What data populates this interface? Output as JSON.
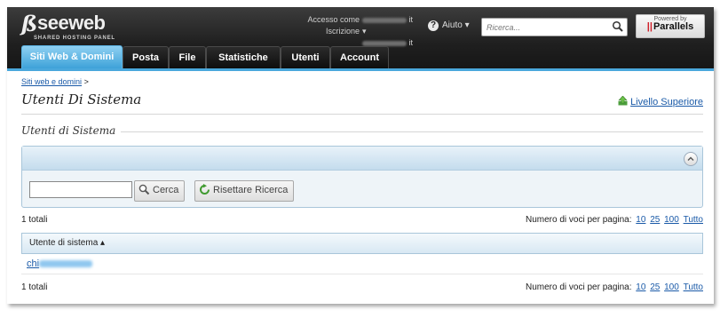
{
  "header": {
    "logo_text": "seeweb",
    "logo_sub": "SHARED HOSTING PANEL",
    "access_label": "Accesso come",
    "signup_label": "Iscrizione",
    "access_suffix": "it",
    "signup_suffix": "it",
    "help_label": "Aiuto",
    "search_placeholder": "Ricerca...",
    "powered_by": "Powered by",
    "parallels": "Parallels"
  },
  "tabs": [
    {
      "label": "Siti Web & Domini",
      "active": true
    },
    {
      "label": "Posta",
      "active": false
    },
    {
      "label": "File",
      "active": false
    },
    {
      "label": "Statistiche",
      "active": false
    },
    {
      "label": "Utenti",
      "active": false
    },
    {
      "label": "Account",
      "active": false
    }
  ],
  "breadcrumb": {
    "link": "Siti web e domini",
    "sep": ">"
  },
  "page_title": "Utenti Di Sistema",
  "upper_level": "Livello Superiore",
  "section_title": "Utenti di Sistema",
  "filter": {
    "value": "",
    "search_button": "Cerca",
    "reset_button": "Risettare Ricerca"
  },
  "list": {
    "totals": "1 totali",
    "per_page_label": "Numero di voci per pagina:",
    "per_page_options": [
      "10",
      "25",
      "100",
      "Tutto"
    ],
    "column_header": "Utente di sistema",
    "rows": [
      {
        "user": "chi"
      }
    ]
  },
  "colors": {
    "tab_active": "#3aa0d8",
    "link": "#1a5aa8",
    "header_bg": "#1f1f1f"
  }
}
